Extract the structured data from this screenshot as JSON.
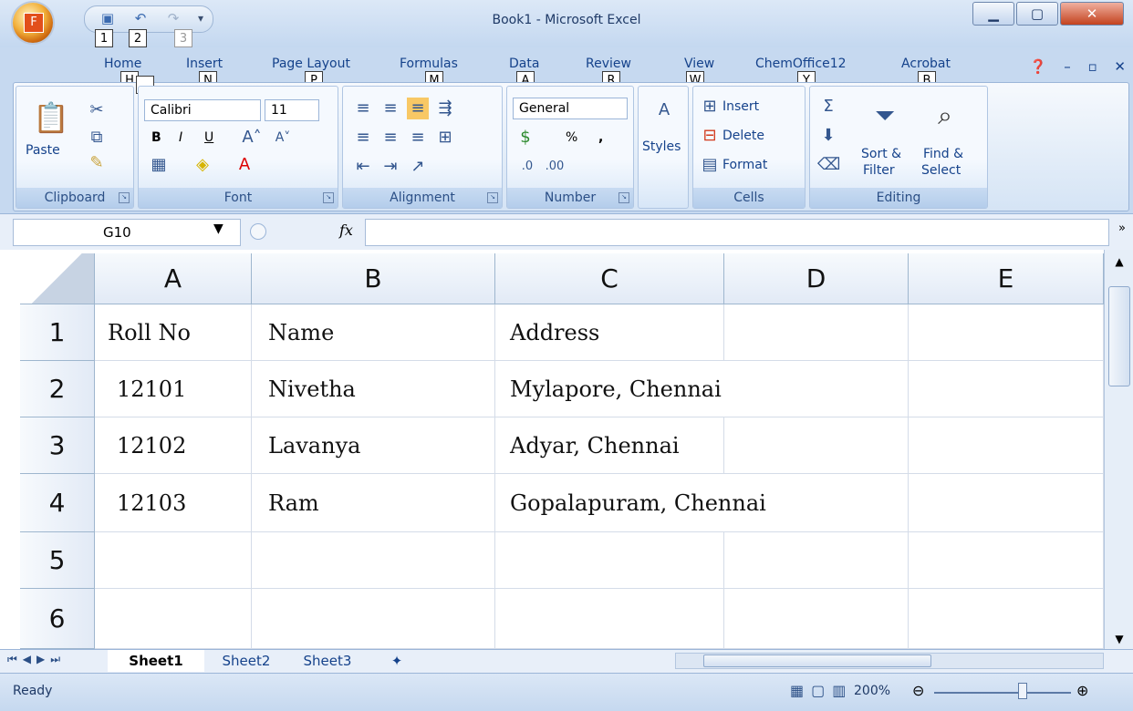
{
  "window": {
    "title": "Book1 - Microsoft Excel"
  },
  "office_button": {
    "label": "F"
  },
  "keytips": {
    "qat1": "1",
    "qat2": "2",
    "qat3": "3",
    "home": "H",
    "insert": "N",
    "page_layout": "P",
    "formulas": "M",
    "data": "A",
    "review": "R",
    "view": "W",
    "chemoffice": "Y",
    "acrobat": "B"
  },
  "tabs": [
    "Home",
    "Insert",
    "Page Layout",
    "Formulas",
    "Data",
    "Review",
    "View",
    "ChemOffice12",
    "Acrobat"
  ],
  "ribbon": {
    "clipboard": {
      "label": "Clipboard",
      "paste": "Paste"
    },
    "font": {
      "label": "Font",
      "name": "Calibri",
      "size": "11",
      "bold": "B",
      "italic": "I",
      "underline": "U"
    },
    "alignment": {
      "label": "Alignment"
    },
    "number": {
      "label": "Number",
      "format": "General",
      "percent": "%",
      "comma": ","
    },
    "styles": {
      "label": "Styles"
    },
    "cells": {
      "label": "Cells",
      "insert": "Insert",
      "delete": "Delete",
      "format": "Format"
    },
    "editing": {
      "label": "Editing",
      "sort": "Sort &",
      "filter": "Filter",
      "find": "Find &",
      "select": "Select"
    }
  },
  "formula_bar": {
    "name_box": "G10",
    "fx": "fx",
    "value": ""
  },
  "columns": [
    "A",
    "B",
    "C",
    "D",
    "E"
  ],
  "rows": [
    {
      "num": "1",
      "a": "Roll No",
      "b": "Name",
      "c": "Address"
    },
    {
      "num": "2",
      "a": "12101",
      "b": "Nivetha",
      "c": "Mylapore, Chennai"
    },
    {
      "num": "3",
      "a": "12102",
      "b": "Lavanya",
      "c": "Adyar, Chennai"
    },
    {
      "num": "4",
      "a": "12103",
      "b": "Ram",
      "c": "Gopalapuram, Chennai"
    },
    {
      "num": "5",
      "a": "",
      "b": "",
      "c": ""
    },
    {
      "num": "6",
      "a": "",
      "b": "",
      "c": ""
    }
  ],
  "sheets": [
    "Sheet1",
    "Sheet2",
    "Sheet3"
  ],
  "active_sheet": "Sheet1",
  "status": {
    "text": "Ready",
    "zoom": "200%"
  }
}
